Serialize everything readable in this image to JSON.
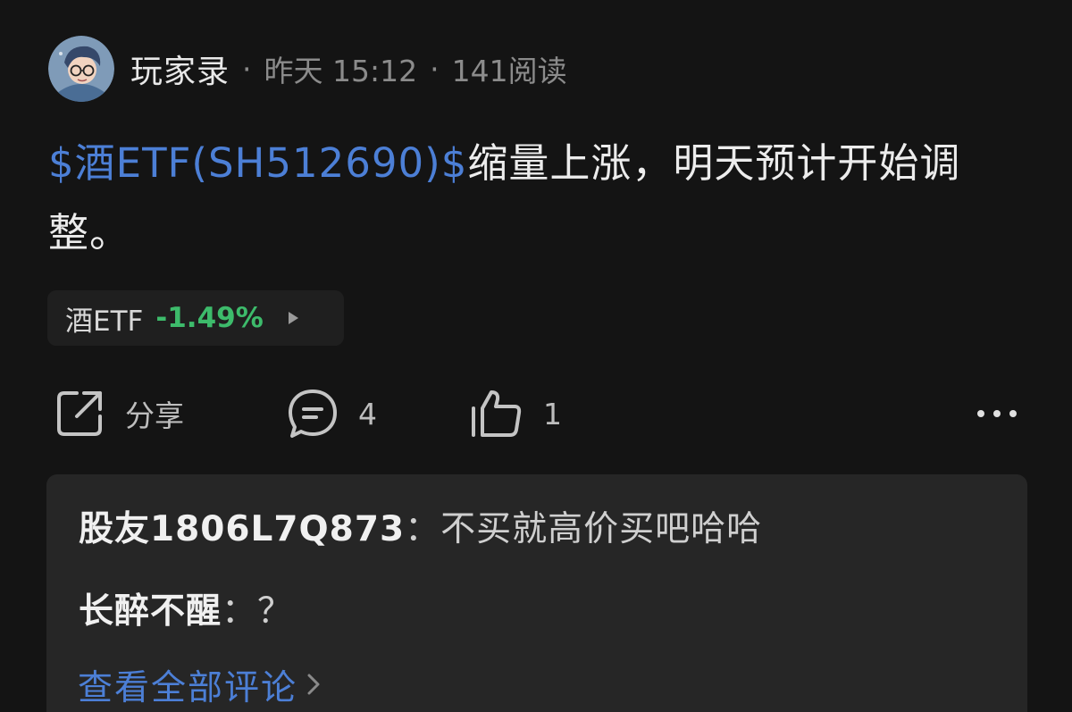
{
  "header": {
    "author": "玩家录",
    "separator": "·",
    "time": "昨天 15:12",
    "reads": "141阅读"
  },
  "post": {
    "stock_link": "$酒ETF(SH512690)$",
    "text": "缩量上涨，明天预计开始调整。"
  },
  "quote_chip": {
    "name": "酒ETF",
    "change": "-1.49%",
    "change_color": "#3dbb6b"
  },
  "actions": {
    "share_label": "分享",
    "comment_count": "4",
    "like_count": "1"
  },
  "comments": [
    {
      "user": "股友1806L7Q873",
      "separator": "：",
      "text": "不买就高价买吧哈哈"
    },
    {
      "user": "长醉不醒",
      "separator": "：",
      "text": "？"
    }
  ],
  "view_all": "查看全部评论",
  "colors": {
    "background": "#141414",
    "link_blue": "#4c7fd6",
    "card": "#262626"
  },
  "icons": [
    "avatar-icon",
    "share-icon",
    "comment-icon",
    "like-icon",
    "more-icon",
    "chevron-right-icon"
  ]
}
